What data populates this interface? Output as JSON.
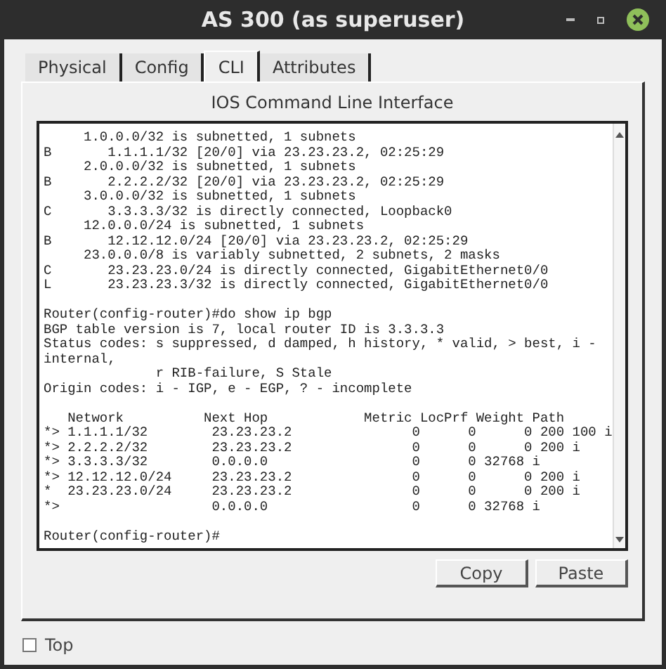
{
  "window": {
    "title": "AS 300 (as superuser)"
  },
  "tabs": [
    {
      "label": "Physical",
      "selected": false
    },
    {
      "label": "Config",
      "selected": false
    },
    {
      "label": "CLI",
      "selected": true
    },
    {
      "label": "Attributes",
      "selected": false
    }
  ],
  "panel": {
    "heading": "IOS Command Line Interface"
  },
  "terminal": {
    "blocks": [
      [
        "     1.0.0.0/32 is subnetted, 1 subnets",
        "B       1.1.1.1/32 [20/0] via 23.23.23.2, 02:25:29",
        "     2.0.0.0/32 is subnetted, 1 subnets",
        "B       2.2.2.2/32 [20/0] via 23.23.23.2, 02:25:29",
        "     3.0.0.0/32 is subnetted, 1 subnets",
        "C       3.3.3.3/32 is directly connected, Loopback0",
        "     12.0.0.0/24 is subnetted, 1 subnets",
        "B       12.12.12.0/24 [20/0] via 23.23.23.2, 02:25:29",
        "     23.0.0.0/8 is variably subnetted, 2 subnets, 2 masks",
        "C       23.23.23.0/24 is directly connected, GigabitEthernet0/0",
        "L       23.23.23.3/32 is directly connected, GigabitEthernet0/0"
      ],
      [
        "Router(config-router)#do show ip bgp",
        "BGP table version is 7, local router ID is 3.3.3.3",
        "Status codes: s suppressed, d damped, h history, * valid, > best, i -",
        "internal,",
        "              r RIB-failure, S Stale",
        "Origin codes: i - IGP, e - EGP, ? - incomplete"
      ],
      [
        "   Network          Next Hop            Metric LocPrf Weight Path",
        "*> 1.1.1.1/32        23.23.23.2               0      0      0 200 100 i",
        "*> 2.2.2.2/32        23.23.23.2               0      0      0 200 i",
        "*> 3.3.3.3/32        0.0.0.0                  0      0 32768 i",
        "*> 12.12.12.0/24     23.23.23.2               0      0      0 200 i",
        "*  23.23.23.0/24     23.23.23.2               0      0      0 200 i",
        "*>                   0.0.0.0                  0      0 32768 i"
      ],
      [
        "Router(config-router)#"
      ]
    ]
  },
  "buttons": [
    "Copy",
    "Paste"
  ],
  "top_checkbox": {
    "label": "Top",
    "checked": false
  }
}
